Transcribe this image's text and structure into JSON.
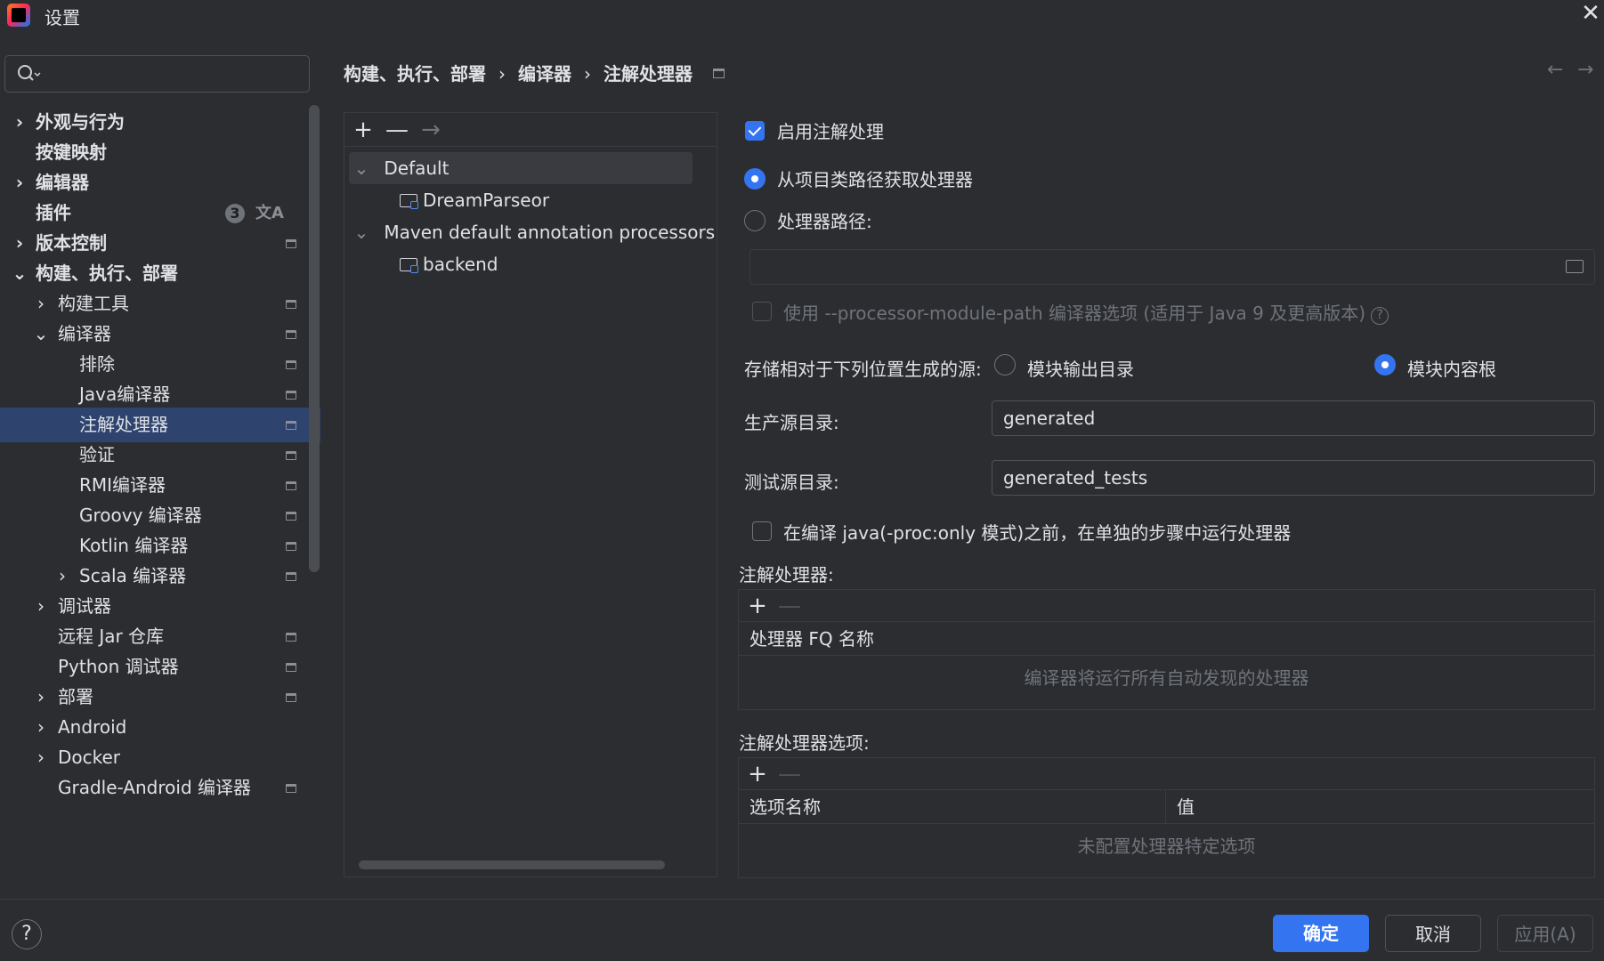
{
  "window": {
    "title": "设置",
    "close_glyph": "✕"
  },
  "search": {
    "placeholder": "",
    "value": ""
  },
  "sidebar": {
    "items": [
      {
        "label": "外观与行为",
        "chevron": "›"
      },
      {
        "label": "按键映射"
      },
      {
        "label": "编辑器",
        "chevron": "›"
      },
      {
        "label": "插件",
        "badge": "3"
      },
      {
        "label": "版本控制",
        "chevron": "›"
      },
      {
        "label": "构建、执行、部署",
        "chevron": "⌄"
      },
      {
        "label": "构建工具",
        "chevron": "›"
      },
      {
        "label": "编译器",
        "chevron": "⌄"
      },
      {
        "label": "排除"
      },
      {
        "label": "Java编译器"
      },
      {
        "label": "注解处理器"
      },
      {
        "label": "验证"
      },
      {
        "label": "RMI编译器"
      },
      {
        "label": "Groovy 编译器"
      },
      {
        "label": "Kotlin 编译器"
      },
      {
        "label": "Scala 编译器",
        "chevron": "›"
      },
      {
        "label": "调试器",
        "chevron": "›"
      },
      {
        "label": "远程 Jar 仓库"
      },
      {
        "label": "Python 调试器"
      },
      {
        "label": "部署",
        "chevron": "›"
      },
      {
        "label": "Android",
        "chevron": "›"
      },
      {
        "label": "Docker",
        "chevron": "›"
      },
      {
        "label": "Gradle-Android 编译器"
      }
    ],
    "translate_glyph": "文A"
  },
  "breadcrumb": {
    "part1": "构建、执行、部署",
    "part2": "编译器",
    "part3": "注解处理器",
    "sep": "›"
  },
  "nav": {
    "back": "←",
    "forward": "→"
  },
  "profiles": {
    "toolbar": {
      "add": "+",
      "remove": "—",
      "move": "→"
    },
    "tree": [
      {
        "label": "Default",
        "chevron": "⌄"
      },
      {
        "label": "DreamParseor"
      },
      {
        "label": "Maven default annotation processors pr",
        "chevron": "⌄"
      },
      {
        "label": "backend"
      }
    ]
  },
  "settings": {
    "enable_label": "启用注解处理",
    "from_classpath_label": "从项目类路径获取处理器",
    "processor_path_label": "处理器路径:",
    "processor_path_value": "",
    "module_path_label": "使用 --processor-module-path 编译器选项 (适用于 Java 9 及更高版本)",
    "help_glyph": "?",
    "store_label": "存储相对于下列位置生成的源:",
    "module_output_label": "模块输出目录",
    "module_content_label": "模块内容根",
    "prod_dir_label": "生产源目录:",
    "prod_dir_value": "generated",
    "test_dir_label": "测试源目录:",
    "test_dir_value": "generated_tests",
    "separate_step_label": "在编译 java(-proc:only 模式)之前，在单独的步骤中运行处理器",
    "processors_title": "注解处理器:",
    "processors_header": "处理器 FQ 名称",
    "processors_empty": "编译器将运行所有自动发现的处理器",
    "options_title": "注解处理器选项:",
    "options_header_name": "选项名称",
    "options_header_value": "值",
    "options_empty": "未配置处理器特定选项",
    "add_glyph": "+",
    "remove_glyph": "—"
  },
  "footer": {
    "help": "?",
    "ok": "确定",
    "cancel": "取消",
    "apply": "应用(A)"
  },
  "colors": {
    "accent": "#3574f0",
    "selected": "#2e436e",
    "background": "#2b2d30"
  }
}
